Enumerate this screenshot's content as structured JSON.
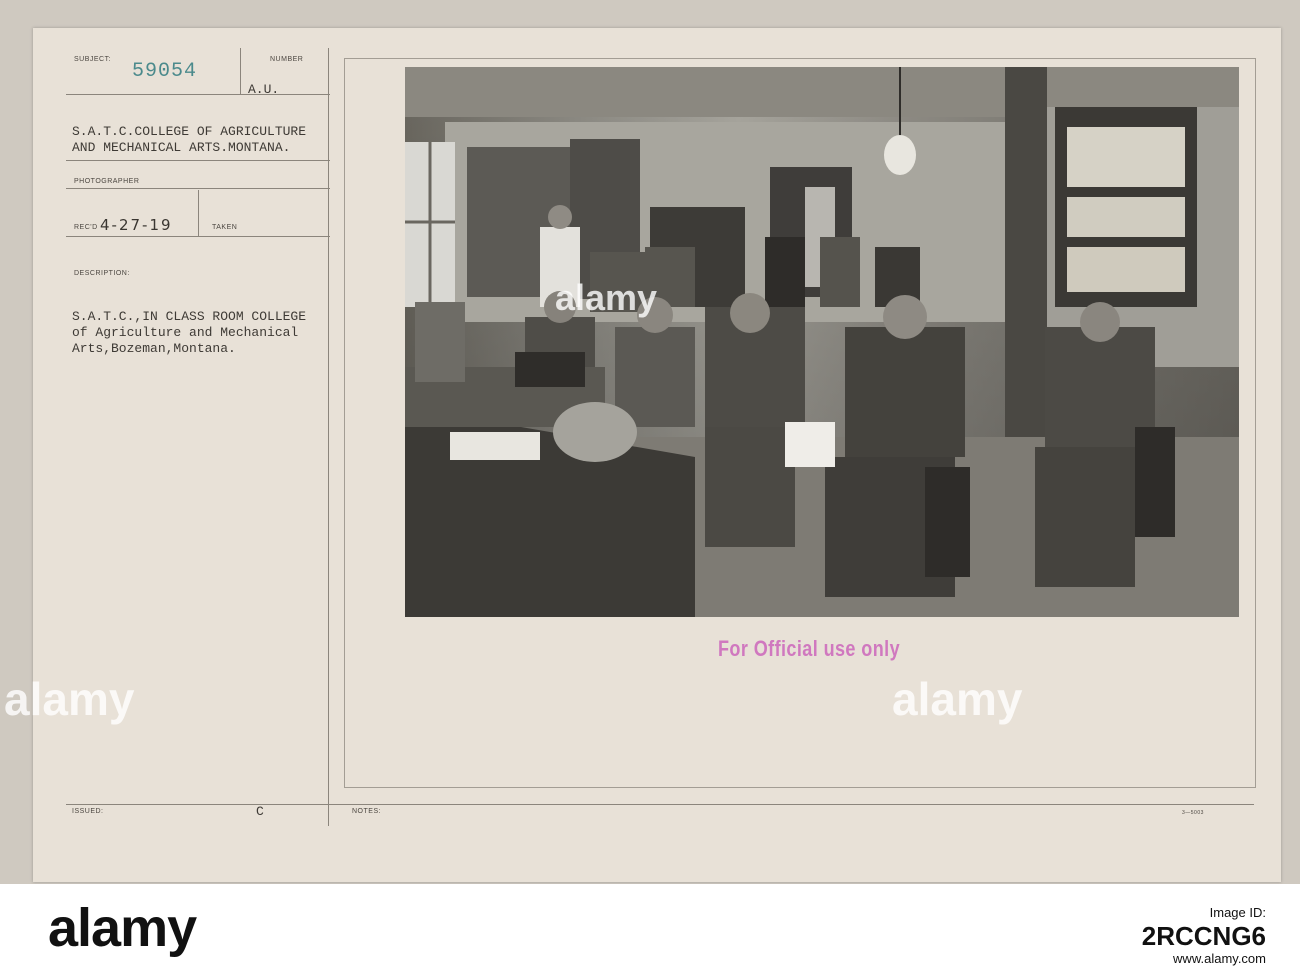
{
  "record": {
    "subject_label": "SUBJECT:",
    "number_label": "NUMBER",
    "subject_number": "59054",
    "number_value": "A.U.",
    "title_line1": "S.A.T.C.COLLEGE OF AGRICULTURE",
    "title_line2": "AND MECHANICAL ARTS.MONTANA.",
    "photographer_label": "PHOTOGRAPHER",
    "recd_label": "REC'D",
    "recd_date": "4-27-19",
    "taken_label": "TAKEN",
    "description_label": "DESCRIPTION:",
    "description_line1": "S.A.T.C.,IN CLASS ROOM COLLEGE",
    "description_line2": "of Agriculture and Mechanical",
    "description_line3": "Arts,Bozeman,Montana.",
    "issued_label": "ISSUED:",
    "issued_value": "C",
    "notes_label": "NOTES:",
    "form_code": "3—5003"
  },
  "stamp": {
    "text": "For Official use only",
    "color": "#d078bf"
  },
  "watermark": {
    "text": "alamy"
  },
  "footer": {
    "logo": "alamy",
    "label": "Image ID:",
    "id": "2RCCNG6",
    "url": "www.alamy.com"
  },
  "photo": {
    "icon": "classroom-photograph"
  }
}
